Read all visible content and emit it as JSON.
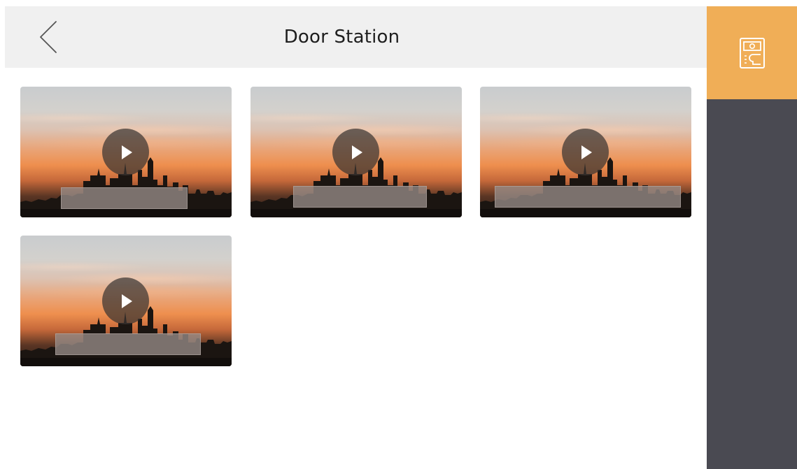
{
  "header": {
    "title": "Door Station",
    "back_icon": "chevron-left-icon"
  },
  "sidebar": {
    "active_tab_icon": "door-station-icon",
    "active_color": "#f0ae57",
    "background_color": "#4a4a52"
  },
  "videos": [
    {
      "icon": "play-icon"
    },
    {
      "icon": "play-icon"
    },
    {
      "icon": "play-icon"
    },
    {
      "icon": "play-icon"
    }
  ]
}
